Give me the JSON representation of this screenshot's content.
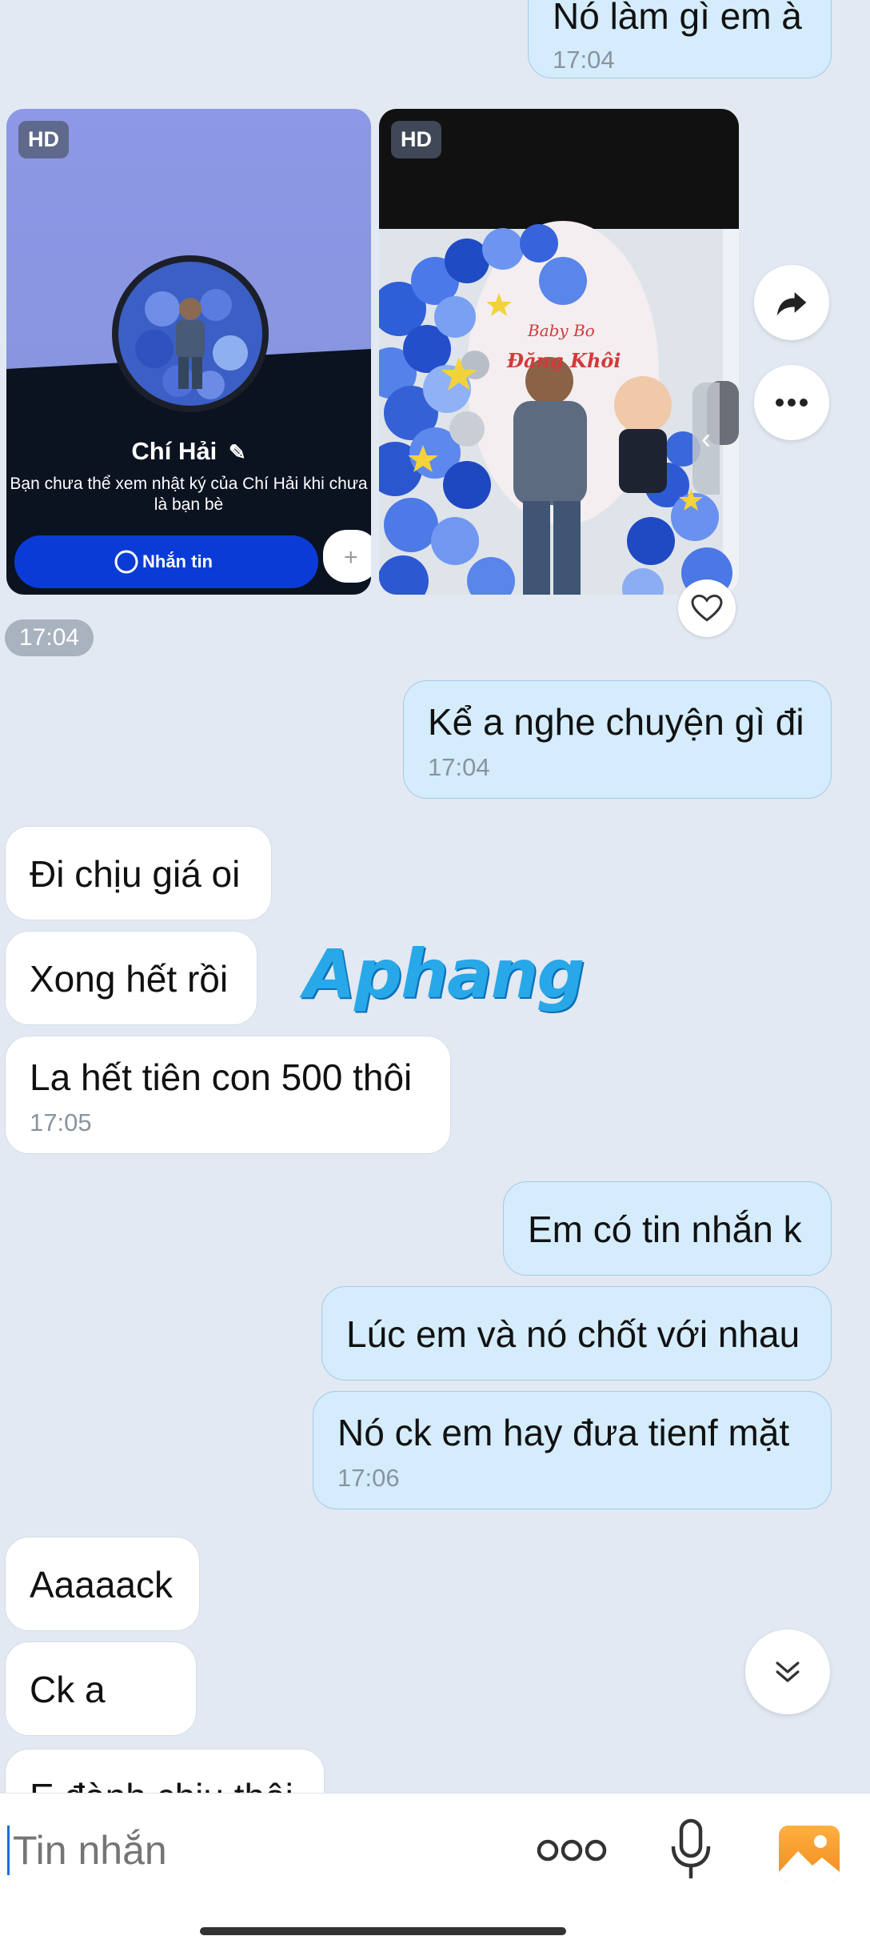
{
  "messages": {
    "m0": {
      "text": "Nó làm gì em à",
      "time": "17:04"
    },
    "m1": {
      "text": "Kể a nghe chuyện gì đi",
      "time": "17:04"
    },
    "m2": {
      "text": "Đi chịu giá oi"
    },
    "m3": {
      "text": "Xong hết rồi"
    },
    "m4": {
      "text": "La hết tiên con 500 thôi",
      "time": "17:05"
    },
    "m5": {
      "text": "Em có tin nhắn k"
    },
    "m6": {
      "text": "Lúc em và nó chốt với nhau"
    },
    "m7": {
      "text": "Nó ck em hay đưa tienf mặt",
      "time": "17:06"
    },
    "m8": {
      "text": "Aaaaack"
    },
    "m9": {
      "text": "Ck a"
    },
    "m10": {
      "text": "E đành chịu thôi"
    }
  },
  "photos": {
    "badge": "HD",
    "time": "17:04",
    "profile_name": "Chí Hải",
    "profile_note": "Bạn chưa thể xem nhật ký của Chí Hải khi chưa là bạn bè",
    "message_button": "Nhắn tin",
    "banner_line1": "Baby Bo",
    "banner_line2": "Đăng Khôi"
  },
  "watermark": "Aphang",
  "composer": {
    "placeholder": "Tin nhắn"
  },
  "colors": {
    "sent_bubble": "#d4ecfc",
    "received_bubble": "#ffffff",
    "background": "#e2e9f2",
    "accent": "#1a6dde"
  }
}
